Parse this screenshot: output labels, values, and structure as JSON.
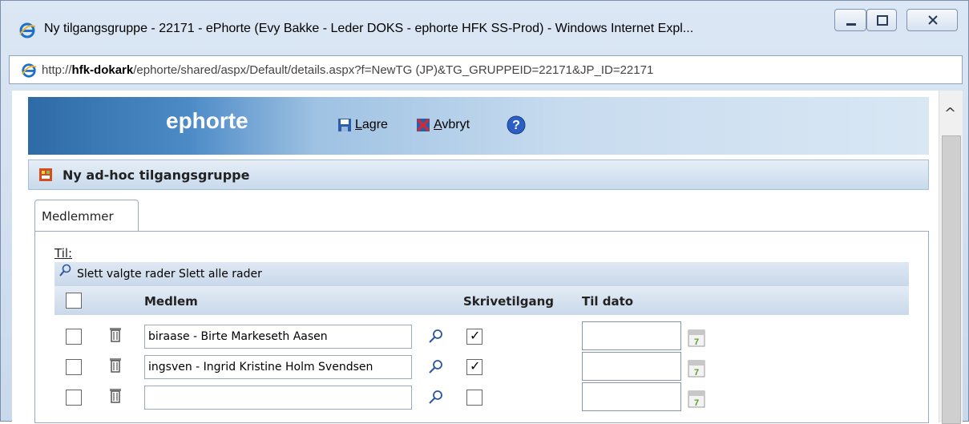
{
  "window": {
    "title": "Ny tilgangsgruppe - 22171 - ePhorte (Evy Bakke - Leder DOKS - ephorte HFK SS-Prod) - Windows Internet Expl...",
    "address_prefix": "http://",
    "address_host": "hfk-dokark",
    "address_path": "/ephorte/shared/aspx/Default/details.aspx?f=NewTG (JP)&TG_GRUPPEID=22171&JP_ID=22171"
  },
  "banner": {
    "logo": "ephorte"
  },
  "toolbar": {
    "save_first": "L",
    "save_rest": "agre",
    "cancel_first": "A",
    "cancel_rest": "vbryt"
  },
  "section": {
    "title": "Ny ad-hoc tilgangsgruppe"
  },
  "tabs": [
    {
      "label": "Medlemmer"
    }
  ],
  "form": {
    "til_label": "Til:",
    "actions_text": "Slett valgte rader Slett alle rader",
    "columns": {
      "medlem": "Medlem",
      "skrivetilgang": "Skrivetilgang",
      "til_dato": "Til dato"
    },
    "rows": [
      {
        "member": "biraase - Birte Markeseth Aasen",
        "skrivetilgang": true,
        "til_dato": ""
      },
      {
        "member": "ingsven - Ingrid Kristine Holm Svendsen",
        "skrivetilgang": true,
        "til_dato": ""
      },
      {
        "member": "",
        "skrivetilgang": false,
        "til_dato": ""
      }
    ],
    "calendar_day": "7"
  },
  "icons": {
    "ie": "ie-icon",
    "save": "save-icon",
    "cancel": "cancel-icon",
    "help": "help-icon",
    "lookup": "lookup-icon",
    "trash": "trash-icon",
    "calendar": "calendar-icon"
  },
  "colors": {
    "banner_dark": "#2d6aa6",
    "banner_light": "#d9e7f4",
    "header_bar": "#c9d8ea"
  }
}
